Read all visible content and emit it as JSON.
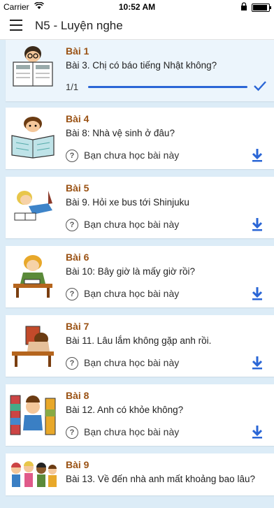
{
  "status_bar": {
    "carrier": "Carrier",
    "time": "10:52 AM"
  },
  "header": {
    "title": "N5 - Luyện nghe"
  },
  "lessons": [
    {
      "title": "Bài 1",
      "subtitle": "Bài 3. Chị có báo tiếng Nhật không?",
      "progress_label": "1/1",
      "progress": 1.0,
      "thumb_icon": "boy-reading-newspaper-icon"
    },
    {
      "title": "Bài 4",
      "subtitle": "Bài 8: Nhà vệ sinh ở đâu?",
      "status": "Bạn chưa học bài này",
      "thumb_icon": "kid-reading-book-icon"
    },
    {
      "title": "Bài 5",
      "subtitle": "Bài 9. Hỏi xe bus tới Shinjuku",
      "status": "Bạn chưa học bài này",
      "thumb_icon": "girl-lying-reading-icon"
    },
    {
      "title": "Bài 6",
      "subtitle": "Bài 10: Bây giờ là mấy giờ rồi?",
      "status": "Bạn chưa học bài này",
      "thumb_icon": "boy-at-desk-icon"
    },
    {
      "title": "Bài 7",
      "subtitle": "Bài 11. Lâu lắm không gặp anh rồi.",
      "status": "Bạn chưa học bài này",
      "thumb_icon": "student-sleeping-desk-icon"
    },
    {
      "title": "Bài 8",
      "subtitle": "Bài 12. Anh có khỏe không?",
      "status": "Bạn chưa học bài này",
      "thumb_icon": "student-with-books-icon"
    },
    {
      "title": "Bài 9",
      "subtitle": "Bài 13. Về đến nhà anh mất khoảng bao lâu?",
      "thumb_icon": "group-of-kids-icon"
    }
  ],
  "colors": {
    "title": "#9a5214",
    "accent": "#2a66d6",
    "background": "#dcecf7"
  }
}
